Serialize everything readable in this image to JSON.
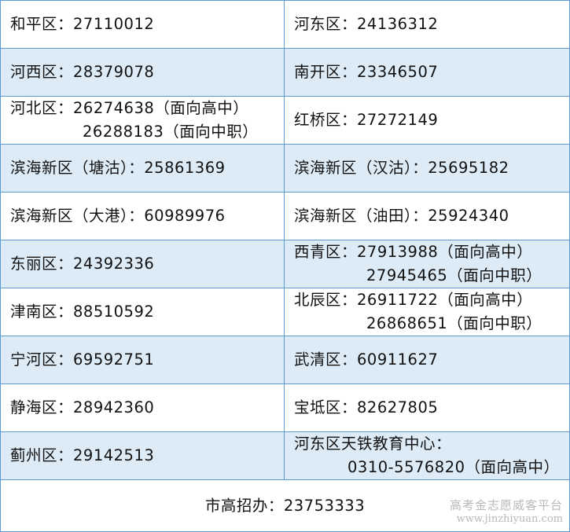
{
  "rows": [
    {
      "left": [
        "和平区：27110012"
      ],
      "right": [
        "河东区：24136312"
      ]
    },
    {
      "left": [
        "河西区：28379078"
      ],
      "right": [
        "南开区：23346507"
      ]
    },
    {
      "left": [
        "河北区：26274638（面向高中）",
        "26288183（面向中职）"
      ],
      "right": [
        "红桥区：27272149"
      ]
    },
    {
      "left": [
        "滨海新区（塘沽）：25861369"
      ],
      "right": [
        "滨海新区（汉沽）：25695182"
      ]
    },
    {
      "left": [
        "滨海新区（大港）：60989976"
      ],
      "right": [
        "滨海新区（油田）：25924340"
      ]
    },
    {
      "left": [
        "东丽区：24392336"
      ],
      "right": [
        "西青区：27913988（面向高中）",
        "27945465（面向中职）"
      ]
    },
    {
      "left": [
        "津南区：88510592"
      ],
      "right": [
        "北辰区：26911722（面向高中）",
        "26868651（面向中职）"
      ]
    },
    {
      "left": [
        "宁河区：69592751"
      ],
      "right": [
        "武清区：60911627"
      ]
    },
    {
      "left": [
        "静海区：28942360"
      ],
      "right": [
        "宝坻区：82627805"
      ]
    },
    {
      "left": [
        "蓟州区：29142513"
      ],
      "right": [
        "河东区天铁教育中心：",
        "0310-5576820（面向高中）"
      ]
    }
  ],
  "footer": "市高招办：23753333",
  "watermark": {
    "name": "高考金志愿威客平台",
    "url": "www.jinzhiyuan.com"
  },
  "colors": {
    "border": "#5b9bd5",
    "band": "#ddebf7"
  }
}
